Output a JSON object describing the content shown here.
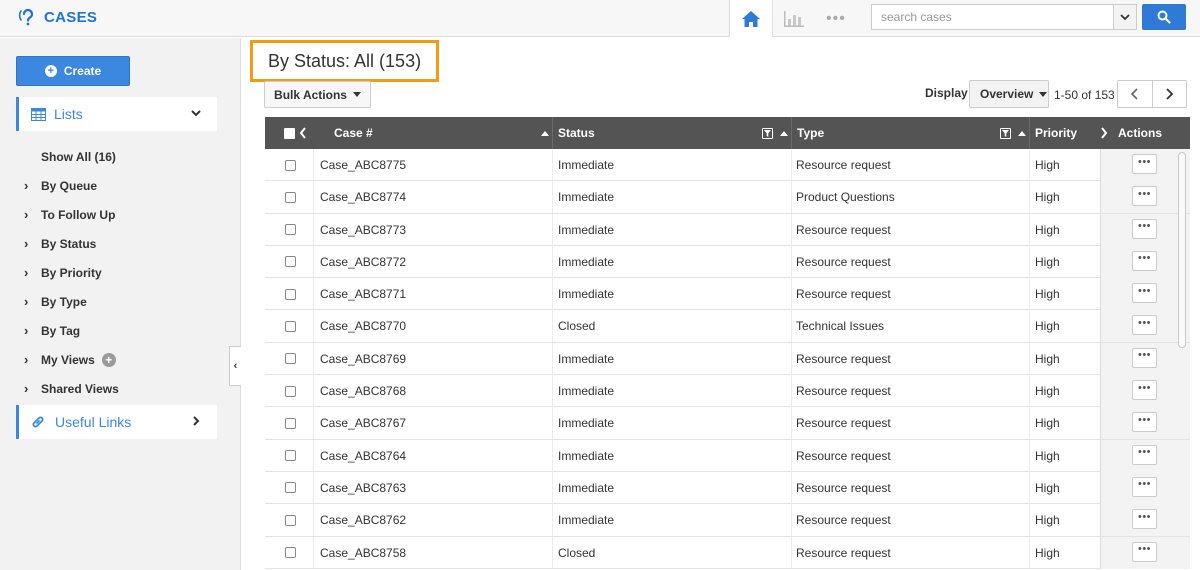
{
  "app": {
    "title": "CASES",
    "brand_color": "#1e73d6"
  },
  "header": {
    "home_icon": "home-icon",
    "chart_icon": "bar-chart-icon",
    "more_icon": "more-dots-icon",
    "more_text": "•••",
    "search": {
      "placeholder": "search cases",
      "value": ""
    },
    "search_icon": "search-icon"
  },
  "sidebar": {
    "create_label": "Create",
    "lists_label": "Lists",
    "useful_links_label": "Useful Links",
    "items": [
      {
        "label": "Show All (16)",
        "has_arrow": false
      },
      {
        "label": "By Queue",
        "has_arrow": true
      },
      {
        "label": "To Follow Up",
        "has_arrow": true
      },
      {
        "label": "By Status",
        "has_arrow": true
      },
      {
        "label": "By Priority",
        "has_arrow": true
      },
      {
        "label": "By Type",
        "has_arrow": true
      },
      {
        "label": "By Tag",
        "has_arrow": true
      },
      {
        "label": "My Views",
        "has_arrow": true,
        "has_add": true
      },
      {
        "label": "Shared Views",
        "has_arrow": true
      }
    ],
    "arrow_glyph": "›",
    "add_glyph": "+",
    "collapse_glyph": "‹"
  },
  "main": {
    "page_title": "By Status: All (153)",
    "bulk_actions_label": "Bulk Actions",
    "display_label": "Display",
    "display_value": "Overview",
    "range_label": "1-50 of 153",
    "highlight_color": "#f39c12"
  },
  "table": {
    "columns": {
      "case": "Case #",
      "status": "Status",
      "type": "Type",
      "priority": "Priority",
      "actions": "Actions"
    },
    "more_glyph": "•••",
    "rows": [
      {
        "case": "Case_ABC8775",
        "status": "Immediate",
        "type": "Resource request",
        "priority": "High"
      },
      {
        "case": "Case_ABC8774",
        "status": "Immediate",
        "type": "Product Questions",
        "priority": "High"
      },
      {
        "case": "Case_ABC8773",
        "status": "Immediate",
        "type": "Resource request",
        "priority": "High"
      },
      {
        "case": "Case_ABC8772",
        "status": "Immediate",
        "type": "Resource request",
        "priority": "High"
      },
      {
        "case": "Case_ABC8771",
        "status": "Immediate",
        "type": "Resource request",
        "priority": "High"
      },
      {
        "case": "Case_ABC8770",
        "status": "Closed",
        "type": "Technical Issues",
        "priority": "High"
      },
      {
        "case": "Case_ABC8769",
        "status": "Immediate",
        "type": "Resource request",
        "priority": "High"
      },
      {
        "case": "Case_ABC8768",
        "status": "Immediate",
        "type": "Resource request",
        "priority": "High"
      },
      {
        "case": "Case_ABC8767",
        "status": "Immediate",
        "type": "Resource request",
        "priority": "High"
      },
      {
        "case": "Case_ABC8764",
        "status": "Immediate",
        "type": "Resource request",
        "priority": "High"
      },
      {
        "case": "Case_ABC8763",
        "status": "Immediate",
        "type": "Resource request",
        "priority": "High"
      },
      {
        "case": "Case_ABC8762",
        "status": "Immediate",
        "type": "Resource request",
        "priority": "High"
      },
      {
        "case": "Case_ABC8758",
        "status": "Closed",
        "type": "Resource request",
        "priority": "High"
      }
    ]
  }
}
